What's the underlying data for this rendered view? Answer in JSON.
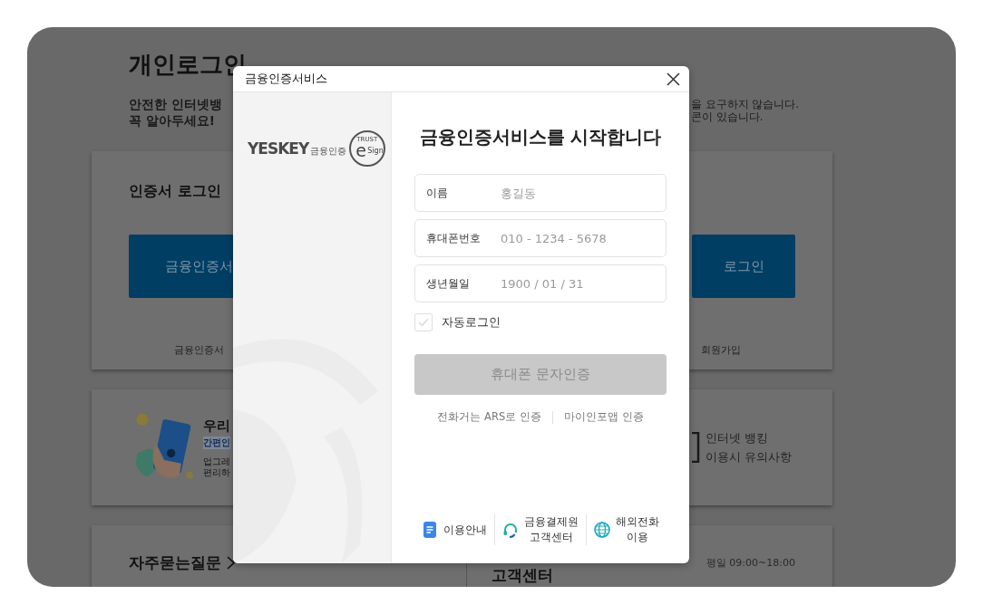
{
  "page": {
    "title": "개인로그인",
    "notice_lines": [
      "안전한 인터넷뱅",
      "꼭 알아두세요!"
    ],
    "notice_right_lines": [
      "을 요구하지 않습니다.",
      "콘이 있습니다."
    ]
  },
  "cert_card": {
    "title": "인증서 로그인",
    "left_button": "금융인증서",
    "right_button": "로그인",
    "left_link": "금융인증서",
    "right_link": "회원가입"
  },
  "promo_card": {
    "title": "우리",
    "tag": "간편인",
    "desc_lines": [
      "업그레",
      "편리하"
    ],
    "notice_link": "인터넷 뱅킹\n이용시 유의사항"
  },
  "bottom_card": {
    "faq": "자주묻는질문",
    "support": "고객센터",
    "hours": "평일 09:00~18:00"
  },
  "dialog": {
    "title": "금융인증서비스",
    "logo": {
      "wordmark": "YESKEY",
      "tagline": "금융인증",
      "seal_top": "TRUST",
      "seal_letter": "e",
      "seal_side": "Sign"
    },
    "heading": "금융인증서비스를 시작합니다",
    "fields": [
      {
        "label": "이름",
        "placeholder": "홍길동"
      },
      {
        "label": "휴대폰번호",
        "placeholder": "010 - 1234 - 5678"
      },
      {
        "label": "생년월일",
        "placeholder": "1900 / 01 / 31"
      }
    ],
    "auto_login": {
      "label": "자동로그인",
      "checked": false
    },
    "submit": {
      "label": "휴대폰 문자인증",
      "disabled": true
    },
    "alt_links": [
      "전화거는 ARS로 인증",
      "마이인포앱 인증"
    ],
    "footer": [
      {
        "kind": "guide",
        "label": "이용안내"
      },
      {
        "kind": "support",
        "label": "금융결제원\n고객센터"
      },
      {
        "kind": "overseas",
        "label": "해외전화\n이용"
      }
    ]
  }
}
